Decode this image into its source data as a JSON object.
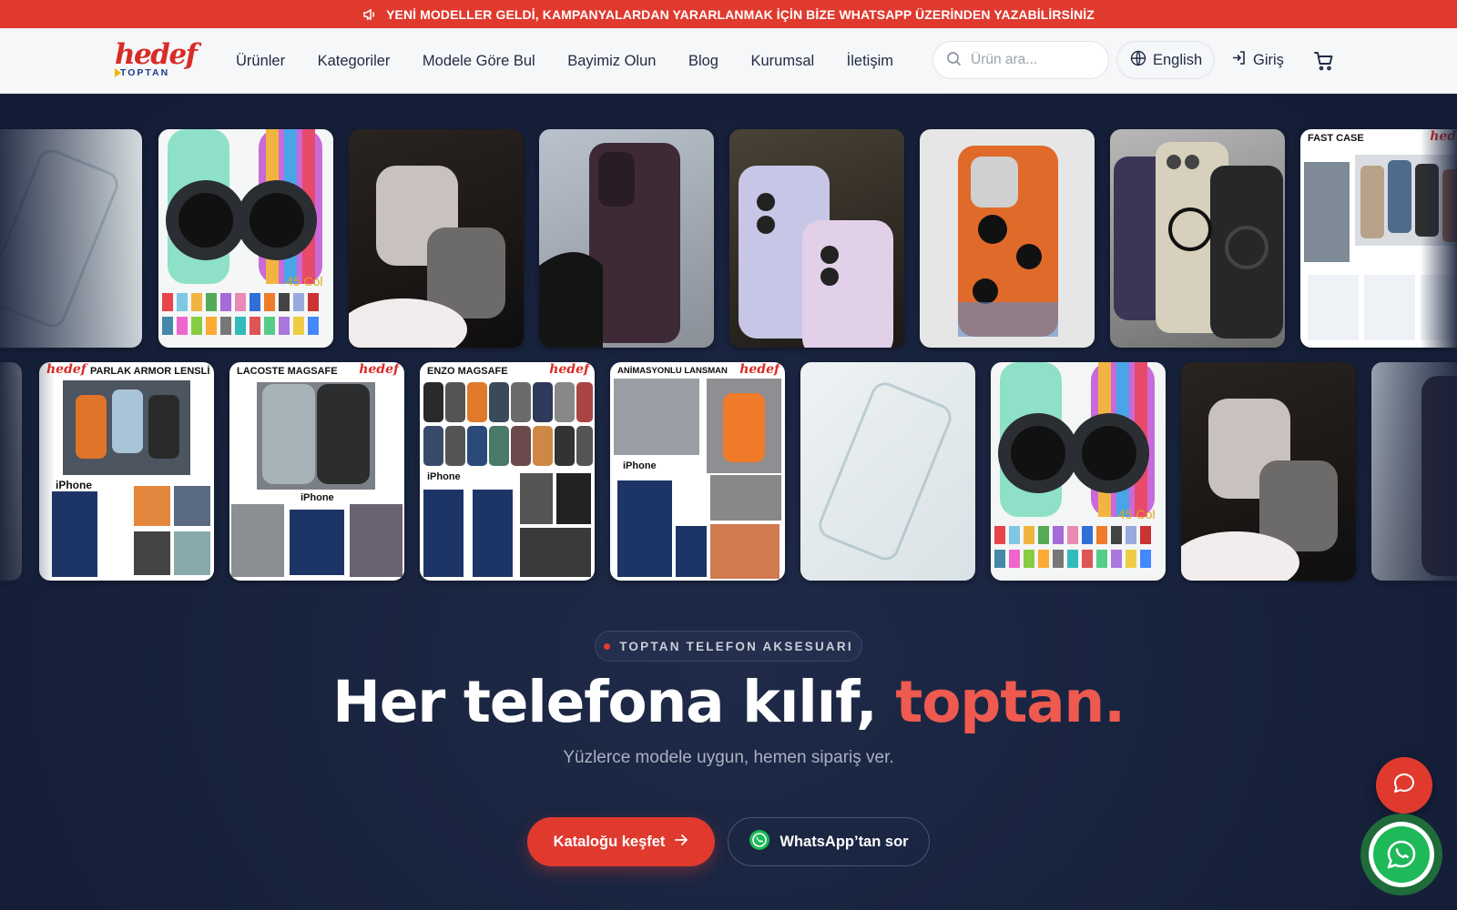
{
  "announcement": {
    "text": "YENİ MODELLER GELDİ, KAMPANYALARDAN YARARLANMAK İÇİN BİZE WHATSAPP ÜZERİNDEN YAZABİLİRSİNİZ",
    "icon": "megaphone-icon"
  },
  "header": {
    "logo_text": "hedef",
    "logo_sub": "TOPTAN",
    "nav": [
      "Ürünler",
      "Kategoriler",
      "Modele Göre Bul",
      "Bayimiz Olun",
      "Blog",
      "Kurumsal",
      "İletişim"
    ],
    "search_placeholder": "Ürün ara...",
    "language": "English",
    "login": "Giriş",
    "cart_icon": "cart-icon"
  },
  "gallery": {
    "row1": [
      {
        "name": "glass-screen-protector",
        "caption": ""
      },
      {
        "name": "braided-watch-band",
        "caption": "45 Col"
      },
      {
        "name": "glitter-airpods-case",
        "caption": ""
      },
      {
        "name": "leather-card-case",
        "caption": ""
      },
      {
        "name": "holographic-iphone-case",
        "caption": ""
      },
      {
        "name": "cat-pattern-case",
        "caption": ""
      },
      {
        "name": "magsafe-camera-case",
        "caption": ""
      },
      {
        "name": "fast-case",
        "caption": "FAST CASE",
        "brand": "hedef"
      }
    ],
    "row2": [
      {
        "name": "edge-tile",
        "caption": ""
      },
      {
        "name": "parlak-armor-lensli",
        "caption": "PARLAK ARMOR LENSLİ",
        "brand": "hedef",
        "label": "iPhone"
      },
      {
        "name": "lacoste-magsafe",
        "caption": "LACOSTE MAGSAFE",
        "brand": "hedef",
        "label": "iPhone"
      },
      {
        "name": "enzo-magsafe",
        "caption": "ENZO MAGSAFE",
        "brand": "hedef",
        "label": "iPhone"
      },
      {
        "name": "animasyonlu-lansman",
        "caption": "ANİMASYONLU LANSMAN",
        "brand": "hedef",
        "label": "iPhone"
      },
      {
        "name": "glass-screen-protector-2",
        "caption": ""
      },
      {
        "name": "braided-watch-band-2",
        "caption": "45 Col"
      },
      {
        "name": "glitter-airpods-case-2",
        "caption": ""
      },
      {
        "name": "leather-card-case-2",
        "caption": ""
      }
    ]
  },
  "hero": {
    "badge": "TOPTAN TELEFON AKSESUARI",
    "headline_main": "Her telefona kılıf, ",
    "headline_accent": "toptan.",
    "subline": "Yüzlerce modele uygun, hemen sipariş ver.",
    "cta_primary": "Kataloğu keşfet",
    "cta_secondary": "WhatsApp’tan sor"
  },
  "colors": {
    "brand_red": "#e03a2f",
    "navy": "#16203a",
    "whatsapp_green": "#1eb958"
  }
}
